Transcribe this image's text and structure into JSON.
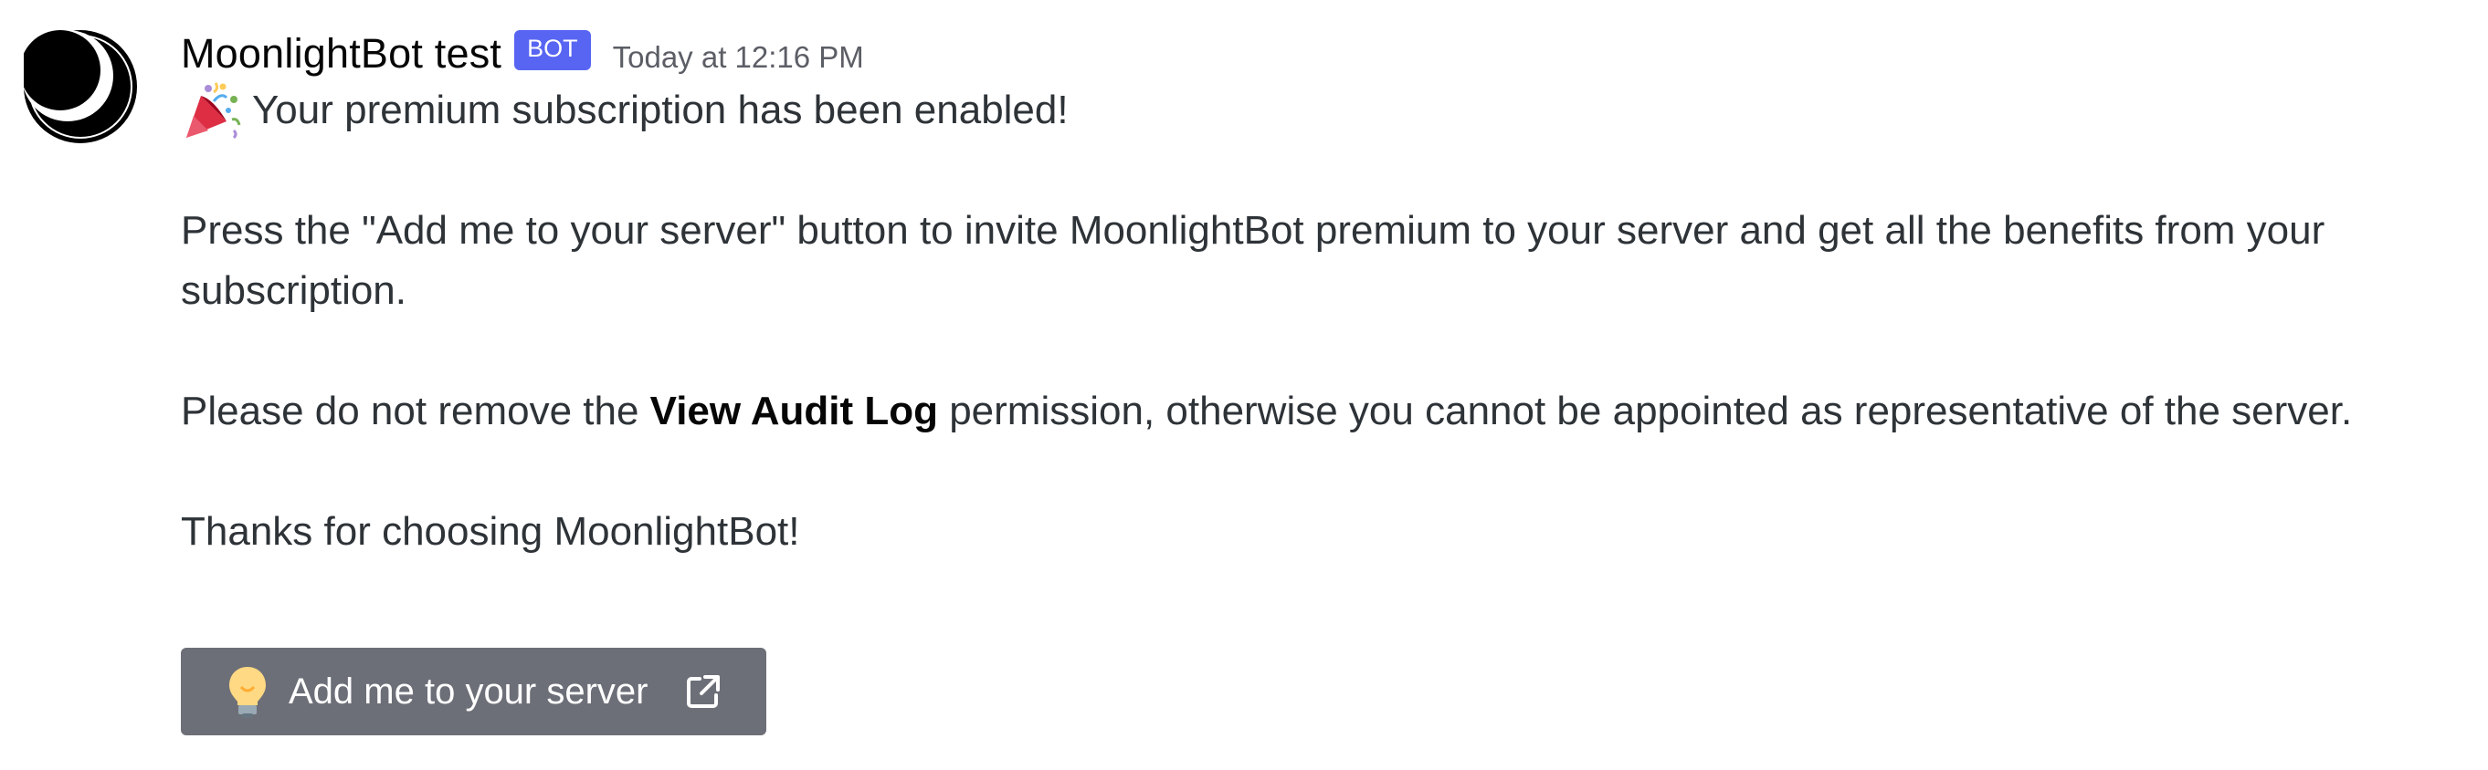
{
  "message": {
    "author": "MoonlightBot test",
    "tag": "BOT",
    "timestamp": "Today at 12:16 PM",
    "line1": "Your premium subscription has been enabled!",
    "para1": "Press the \"Add me to your server\" button to invite MoonlightBot premium to your server and get all the benefits from your subscription.",
    "para2_before": "Please do not remove the ",
    "para2_bold": "View Audit Log",
    "para2_after": " permission, otherwise you cannot be appointed as representative of the server.",
    "para3": "Thanks for choosing MoonlightBot!",
    "button_label": "Add me to your server"
  },
  "icons": {
    "avatar": "moon-avatar-icon",
    "party": "party-popper-icon",
    "bulb": "light-bulb-icon",
    "external": "external-link-icon"
  },
  "colors": {
    "bot_tag": "#5865f2",
    "button": "#6d6f78",
    "username": "#060607",
    "timestamp": "#5c5e66",
    "text": "#2e3338"
  }
}
